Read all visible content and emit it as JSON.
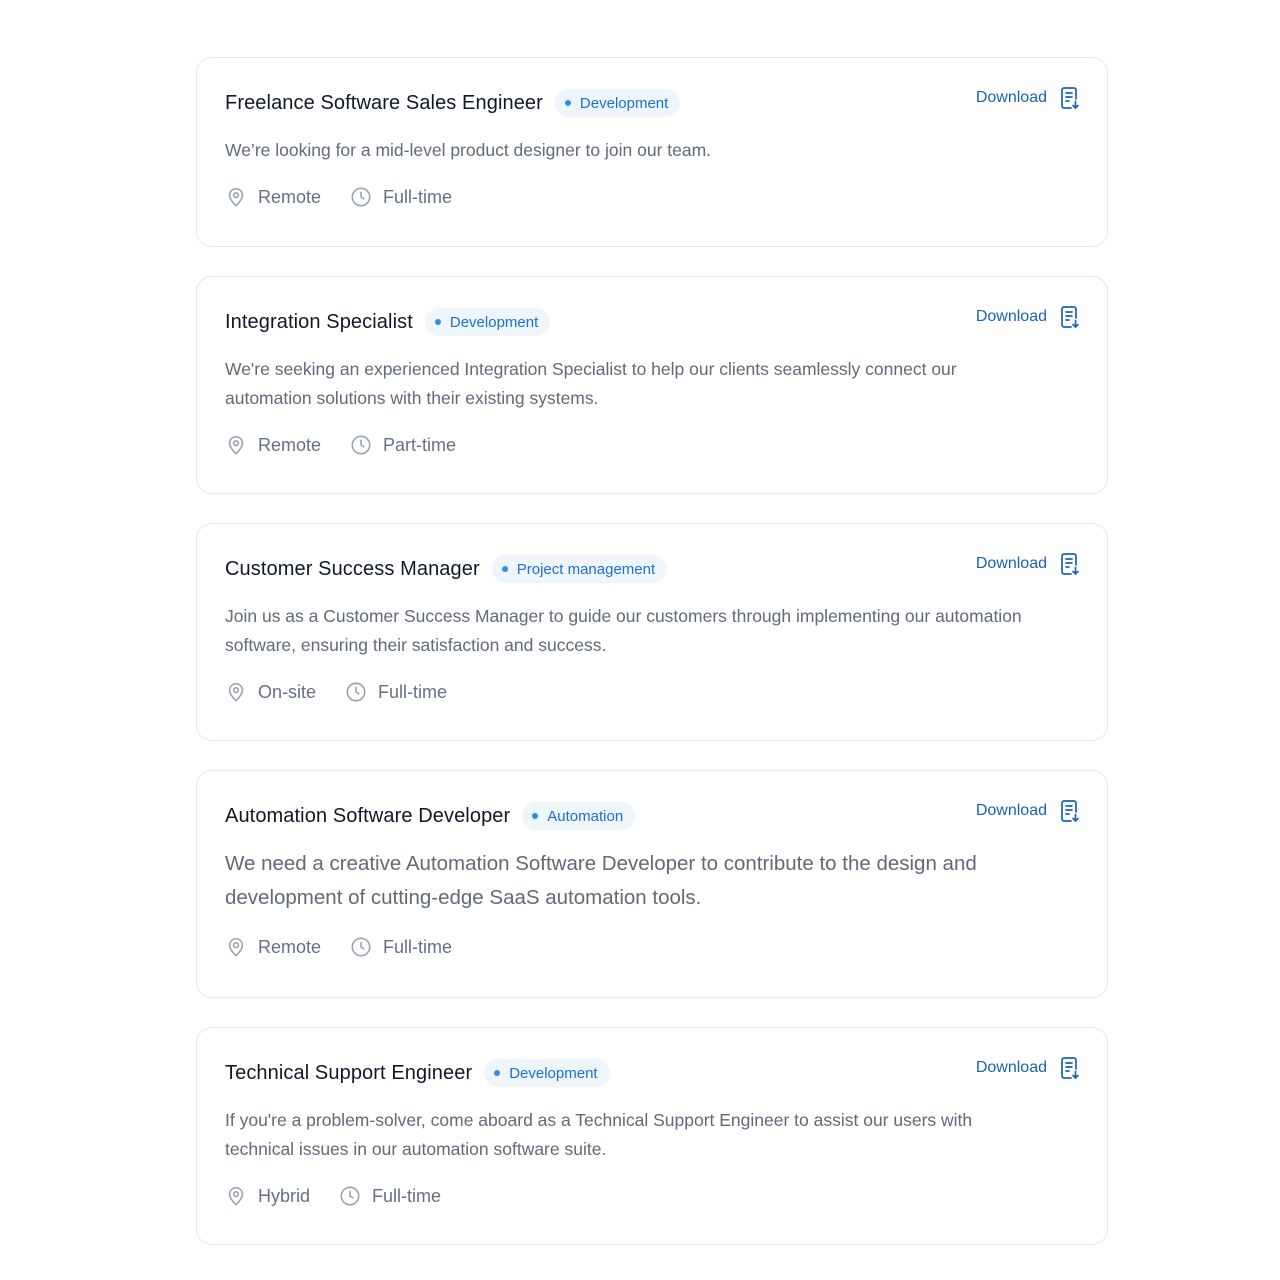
{
  "download_label": "Download",
  "colors": {
    "badge_bg": "#eef6fc",
    "badge_text": "#1d6fd1",
    "download_text": "#1565b4",
    "card_border": "#e4e7ec"
  },
  "jobs": [
    {
      "title": "Freelance Software Sales Engineer",
      "category": "Development",
      "description": "We’re looking for a mid-level product designer to join our team.",
      "location": "Remote",
      "type": "Full-time",
      "location_icon": "map-pin-icon",
      "type_icon": "clock-icon"
    },
    {
      "title": "Integration Specialist",
      "category": "Development",
      "description": "We're seeking an experienced Integration Specialist to help our clients seamlessly connect our automation solutions with their existing systems.",
      "location": "Remote",
      "type": "Part-time",
      "location_icon": "map-pin-icon",
      "type_icon": "clock-icon"
    },
    {
      "title": "Customer Success Manager",
      "category": "Project management",
      "description": "Join us as a Customer Success Manager to guide our customers through implementing our automation software, ensuring their satisfaction and success.",
      "location": "On-site",
      "type": "Full-time",
      "location_icon": "map-pin-icon",
      "type_icon": "clock-icon"
    },
    {
      "title": "Automation Software Developer",
      "category": "Automation",
      "description": "We need a creative Automation Software Developer to contribute to the design and development of cutting-edge SaaS automation tools.",
      "location": "Remote",
      "type": "Full-time",
      "location_icon": "map-pin-icon",
      "type_icon": "clock-icon"
    },
    {
      "title": "Technical Support Engineer",
      "category": "Development",
      "description": "If you're a problem-solver, come aboard as a Technical Support Engineer to assist our users with technical issues in our automation software suite.",
      "location": "Hybrid",
      "type": "Full-time",
      "location_icon": "map-pin-icon",
      "type_icon": "clock-icon"
    }
  ]
}
